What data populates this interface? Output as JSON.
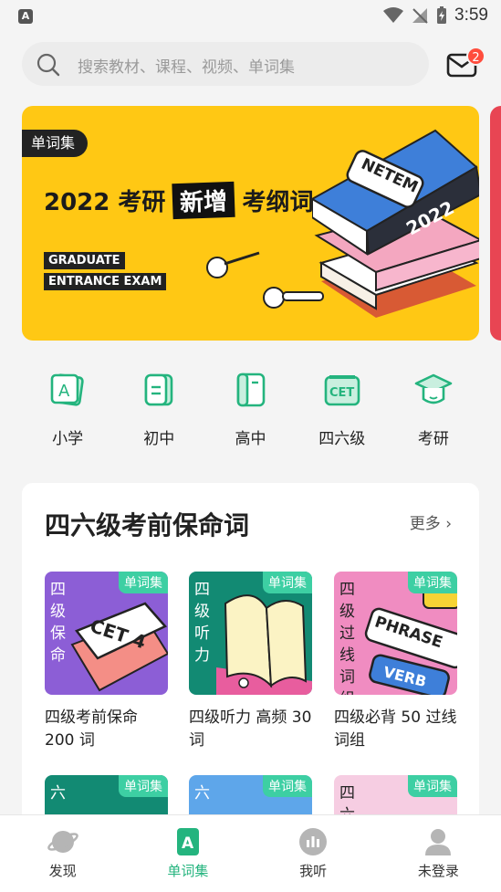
{
  "status": {
    "time": "3:59"
  },
  "search": {
    "placeholder": "搜索教材、课程、视频、单词集"
  },
  "mail": {
    "badge": "2"
  },
  "banner": {
    "tag": "单词集",
    "title_pre": "2022 考研",
    "title_hl": "新增",
    "title_post": "考纲词",
    "sub1": "GRADUATE",
    "sub2": "ENTRANCE EXAM",
    "book_label": "NETEM",
    "book_year": "2022"
  },
  "categories": [
    {
      "label": "小学",
      "icon": "a-book-icon"
    },
    {
      "label": "初中",
      "icon": "notebook-icon"
    },
    {
      "label": "高中",
      "icon": "book-icon"
    },
    {
      "label": "四六级",
      "icon": "cet-icon"
    },
    {
      "label": "考研",
      "icon": "graduation-cap-icon"
    }
  ],
  "section": {
    "title": "四六级考前保命词",
    "more": "更多",
    "badge": "单词集",
    "items": [
      {
        "cover_text": "四级保命",
        "cover_label": "CET 4",
        "title": "四级考前保命 200 词"
      },
      {
        "cover_text": "四级听力",
        "cover_label": "",
        "title": "四级听力 高频 30 词"
      },
      {
        "cover_text": "四级过线词组",
        "cover_label": "PHRASE",
        "cover_label2": "VERB",
        "title": "四级必背 50 过线词组"
      },
      {
        "cover_text": "六"
      },
      {
        "cover_text": "六"
      },
      {
        "cover_text": "四六"
      }
    ]
  },
  "tabs": [
    {
      "label": "发现",
      "icon": "planet-icon"
    },
    {
      "label": "单词集",
      "icon": "a-book-icon"
    },
    {
      "label": "我听",
      "icon": "audio-icon"
    },
    {
      "label": "未登录",
      "icon": "user-icon"
    }
  ],
  "colors": {
    "accent": "#24b47e",
    "banner": "#ffc814",
    "badge": "#ff4d3d",
    "pill": "#3dcfa3"
  }
}
